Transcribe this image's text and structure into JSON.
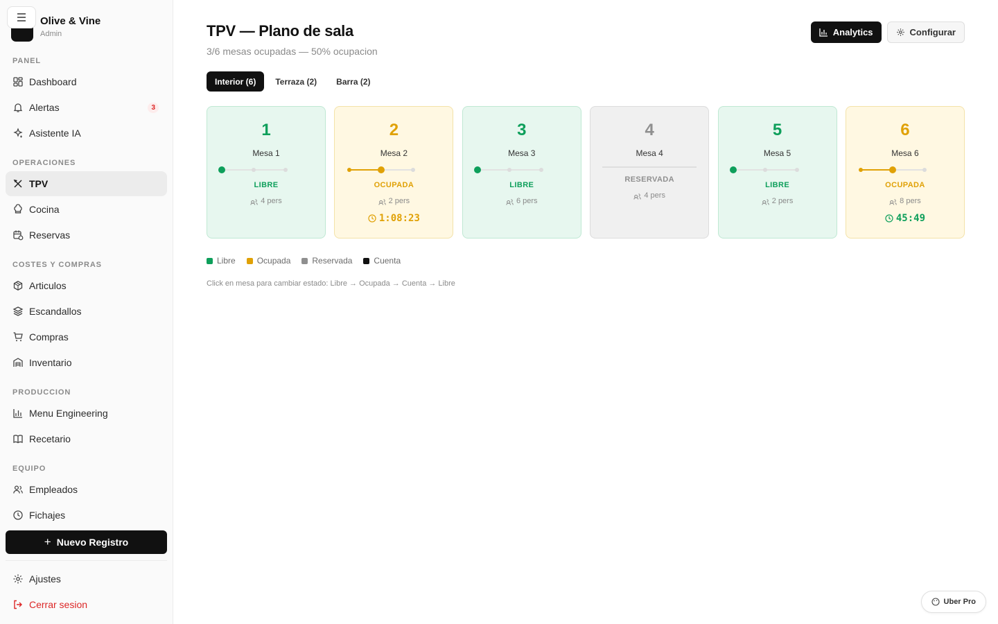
{
  "sidebar": {
    "brand_name": "Olive & Vine",
    "brand_role": "Admin",
    "sections": [
      {
        "title": "PANEL",
        "items": [
          {
            "label": "Dashboard",
            "icon": "dashboard-icon"
          },
          {
            "label": "Alertas",
            "icon": "bell-icon",
            "badge": "3"
          },
          {
            "label": "Asistente IA",
            "icon": "sparkles-icon"
          }
        ]
      },
      {
        "title": "OPERACIONES",
        "items": [
          {
            "label": "TPV",
            "icon": "utensils-icon",
            "active": true
          },
          {
            "label": "Cocina",
            "icon": "chef-hat-icon"
          },
          {
            "label": "Reservas",
            "icon": "calendar-clock-icon"
          }
        ]
      },
      {
        "title": "COSTES Y COMPRAS",
        "items": [
          {
            "label": "Articulos",
            "icon": "package-icon"
          },
          {
            "label": "Escandallos",
            "icon": "layers-icon"
          },
          {
            "label": "Compras",
            "icon": "cart-icon"
          },
          {
            "label": "Inventario",
            "icon": "warehouse-icon"
          }
        ]
      },
      {
        "title": "PRODUCCION",
        "items": [
          {
            "label": "Menu Engineering",
            "icon": "bar-chart-icon"
          },
          {
            "label": "Recetario",
            "icon": "book-icon"
          }
        ]
      },
      {
        "title": "EQUIPO",
        "items": [
          {
            "label": "Empleados",
            "icon": "users-icon"
          },
          {
            "label": "Fichajes",
            "icon": "clock-icon"
          }
        ]
      }
    ],
    "new_button": "Nuevo Registro",
    "settings": "Ajustes",
    "logout": "Cerrar sesion"
  },
  "header": {
    "title": "TPV — Plano de sala",
    "subtitle": "3/6 mesas ocupadas — 50% ocupacion",
    "analytics_label": "Analytics",
    "configure_label": "Configurar"
  },
  "tabs": [
    {
      "label": "Interior (6)",
      "active": true
    },
    {
      "label": "Terraza (2)",
      "active": false
    },
    {
      "label": "Barra (2)",
      "active": false
    }
  ],
  "tables": [
    {
      "number": "1",
      "name": "Mesa 1",
      "status": "LIBRE",
      "state": "libre",
      "people": "4 pers",
      "timer": ""
    },
    {
      "number": "2",
      "name": "Mesa 2",
      "status": "OCUPADA",
      "state": "ocupada",
      "people": "2 pers",
      "timer": "1:08:23"
    },
    {
      "number": "3",
      "name": "Mesa 3",
      "status": "LIBRE",
      "state": "libre",
      "people": "6 pers",
      "timer": ""
    },
    {
      "number": "4",
      "name": "Mesa 4",
      "status": "RESERVADA",
      "state": "reservada",
      "people": "4 pers",
      "timer": ""
    },
    {
      "number": "5",
      "name": "Mesa 5",
      "status": "LIBRE",
      "state": "libre",
      "people": "2 pers",
      "timer": ""
    },
    {
      "number": "6",
      "name": "Mesa 6",
      "status": "OCUPADA",
      "state": "ocupada",
      "people": "8 pers",
      "timer": "45:49"
    }
  ],
  "state_steps": {
    "libre": 0,
    "ocupada": 1,
    "cuenta": 2
  },
  "colors": {
    "libre": "#0e9f5b",
    "ocupada": "#e0a106",
    "reservada": "#8f8f8f",
    "cuenta": "#111111",
    "libre_timer": "#0e9f5b"
  },
  "legend": [
    {
      "label": "Libre",
      "color": "#0e9f5b"
    },
    {
      "label": "Ocupada",
      "color": "#e0a106"
    },
    {
      "label": "Reservada",
      "color": "#8f8f8f"
    },
    {
      "label": "Cuenta",
      "color": "#111111"
    }
  ],
  "hint": "Click en mesa para cambiar estado: Libre → Ocupada → Cuenta → Libre",
  "uber_pro": "Uber Pro"
}
